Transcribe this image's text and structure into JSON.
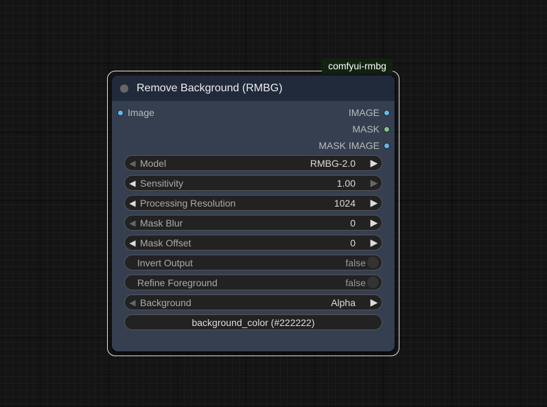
{
  "node": {
    "badge": "comfyui-rmbg",
    "title": "Remove Background (RMBG)",
    "input": {
      "label": "Image",
      "color": "#64b5f6"
    },
    "outputs": [
      {
        "label": "IMAGE",
        "color": "#64b5f6"
      },
      {
        "label": "MASK",
        "color": "#81c784"
      },
      {
        "label": "MASK IMAGE",
        "color": "#64b5f6"
      }
    ],
    "widgets": [
      {
        "type": "combo",
        "label": "Model",
        "value": "RMBG-2.0",
        "left_enabled": false,
        "right_enabled": true
      },
      {
        "type": "number",
        "label": "Sensitivity",
        "value": "1.00",
        "left_enabled": true,
        "right_enabled": false
      },
      {
        "type": "number",
        "label": "Processing Resolution",
        "value": "1024",
        "left_enabled": true,
        "right_enabled": true
      },
      {
        "type": "number",
        "label": "Mask Blur",
        "value": "0",
        "left_enabled": false,
        "right_enabled": true
      },
      {
        "type": "number",
        "label": "Mask Offset",
        "value": "0",
        "left_enabled": true,
        "right_enabled": true
      },
      {
        "type": "toggle",
        "label": "Invert Output",
        "value": "false"
      },
      {
        "type": "toggle",
        "label": "Refine Foreground",
        "value": "false"
      },
      {
        "type": "combo",
        "label": "Background",
        "value": "Alpha",
        "left_enabled": false,
        "right_enabled": true
      }
    ],
    "button": "background_color (#222222)"
  }
}
